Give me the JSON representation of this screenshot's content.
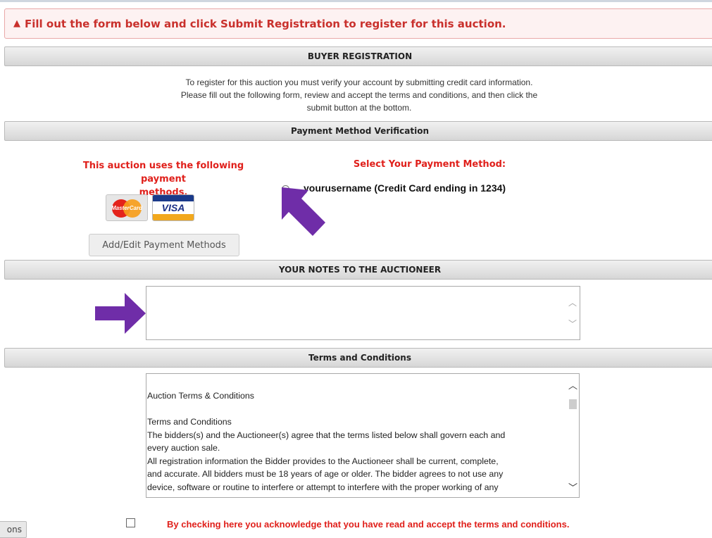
{
  "alert": {
    "icon": "warning-triangle-icon",
    "text": "Fill out the form below and click Submit Registration to register for this auction."
  },
  "sections": {
    "buyer_registration": "BUYER REGISTRATION",
    "payment_verification": "Payment Method Verification",
    "notes": "YOUR NOTES TO THE AUCTIONEER",
    "terms": "Terms and Conditions"
  },
  "intro_lines": [
    "To register for this auction you must verify your account by submitting credit card information.",
    "Please fill out the following form, review and accept the terms and conditions, and then click the",
    "submit button at the bottom."
  ],
  "payment": {
    "accepted_label_line1": "This auction uses the following payment",
    "accepted_label_line2": "methods.",
    "cards": [
      "MasterCard",
      "VISA"
    ],
    "edit_button": "Add/Edit Payment Methods",
    "select_label": "Select Your Payment Method:",
    "option_label": "yourusername (Credit Card ending in 1234)",
    "option_selected": false
  },
  "notes_field": {
    "value": ""
  },
  "terms_text": [
    "Auction Terms & Conditions",
    "",
    "Terms and Conditions",
    "The bidders(s) and the Auctioneer(s) agree that the terms listed below shall govern each and",
    "every auction sale.",
    "All registration information the Bidder provides to the Auctioneer shall be current, complete,",
    "and accurate. All bidders must be 18 years of age or older. The bidder agrees to not use any",
    "device, software or routine to interfere or attempt to interfere with the proper working of any"
  ],
  "acceptance": {
    "checked": false,
    "text": "By checking here you acknowledge that you have read and accept the terms and conditions."
  },
  "left_tab_fragment": "ons",
  "colors": {
    "accent_red": "#e0201b",
    "annotation_arrow": "#6f2da8"
  }
}
